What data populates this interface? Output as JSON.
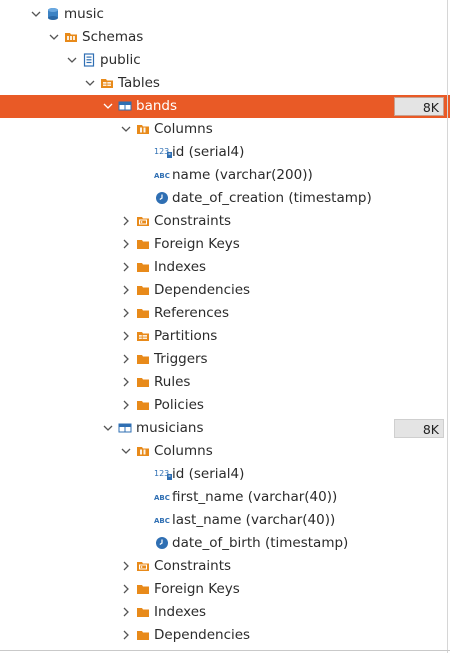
{
  "tree": {
    "music": "music",
    "schemas": "Schemas",
    "public": "public",
    "tables": "Tables",
    "bands": {
      "label": "bands",
      "size": "8K",
      "columns_label": "Columns",
      "columns": [
        {
          "name": "id (serial4)",
          "type_icon": "numeric-icon"
        },
        {
          "name": "name (varchar(200))",
          "type_icon": "text-abc-icon"
        },
        {
          "name": "date_of_creation (timestamp)",
          "type_icon": "clock-icon"
        }
      ],
      "folders": [
        "Constraints",
        "Foreign Keys",
        "Indexes",
        "Dependencies",
        "References",
        "Partitions",
        "Triggers",
        "Rules",
        "Policies"
      ]
    },
    "musicians": {
      "label": "musicians",
      "size": "8K",
      "columns_label": "Columns",
      "columns": [
        {
          "name": "id (serial4)",
          "type_icon": "numeric-icon"
        },
        {
          "name": "first_name (varchar(40))",
          "type_icon": "text-abc-icon"
        },
        {
          "name": "last_name (varchar(40))",
          "type_icon": "text-abc-icon"
        },
        {
          "name": "date_of_birth (timestamp)",
          "type_icon": "clock-icon"
        }
      ],
      "folders": [
        "Constraints",
        "Foreign Keys",
        "Indexes",
        "Dependencies"
      ]
    }
  },
  "colors": {
    "selection": "#e95a26",
    "folder": "#e88a1a",
    "table_icon": "#2f6fb3",
    "badge_bg": "#e4e4e4"
  }
}
